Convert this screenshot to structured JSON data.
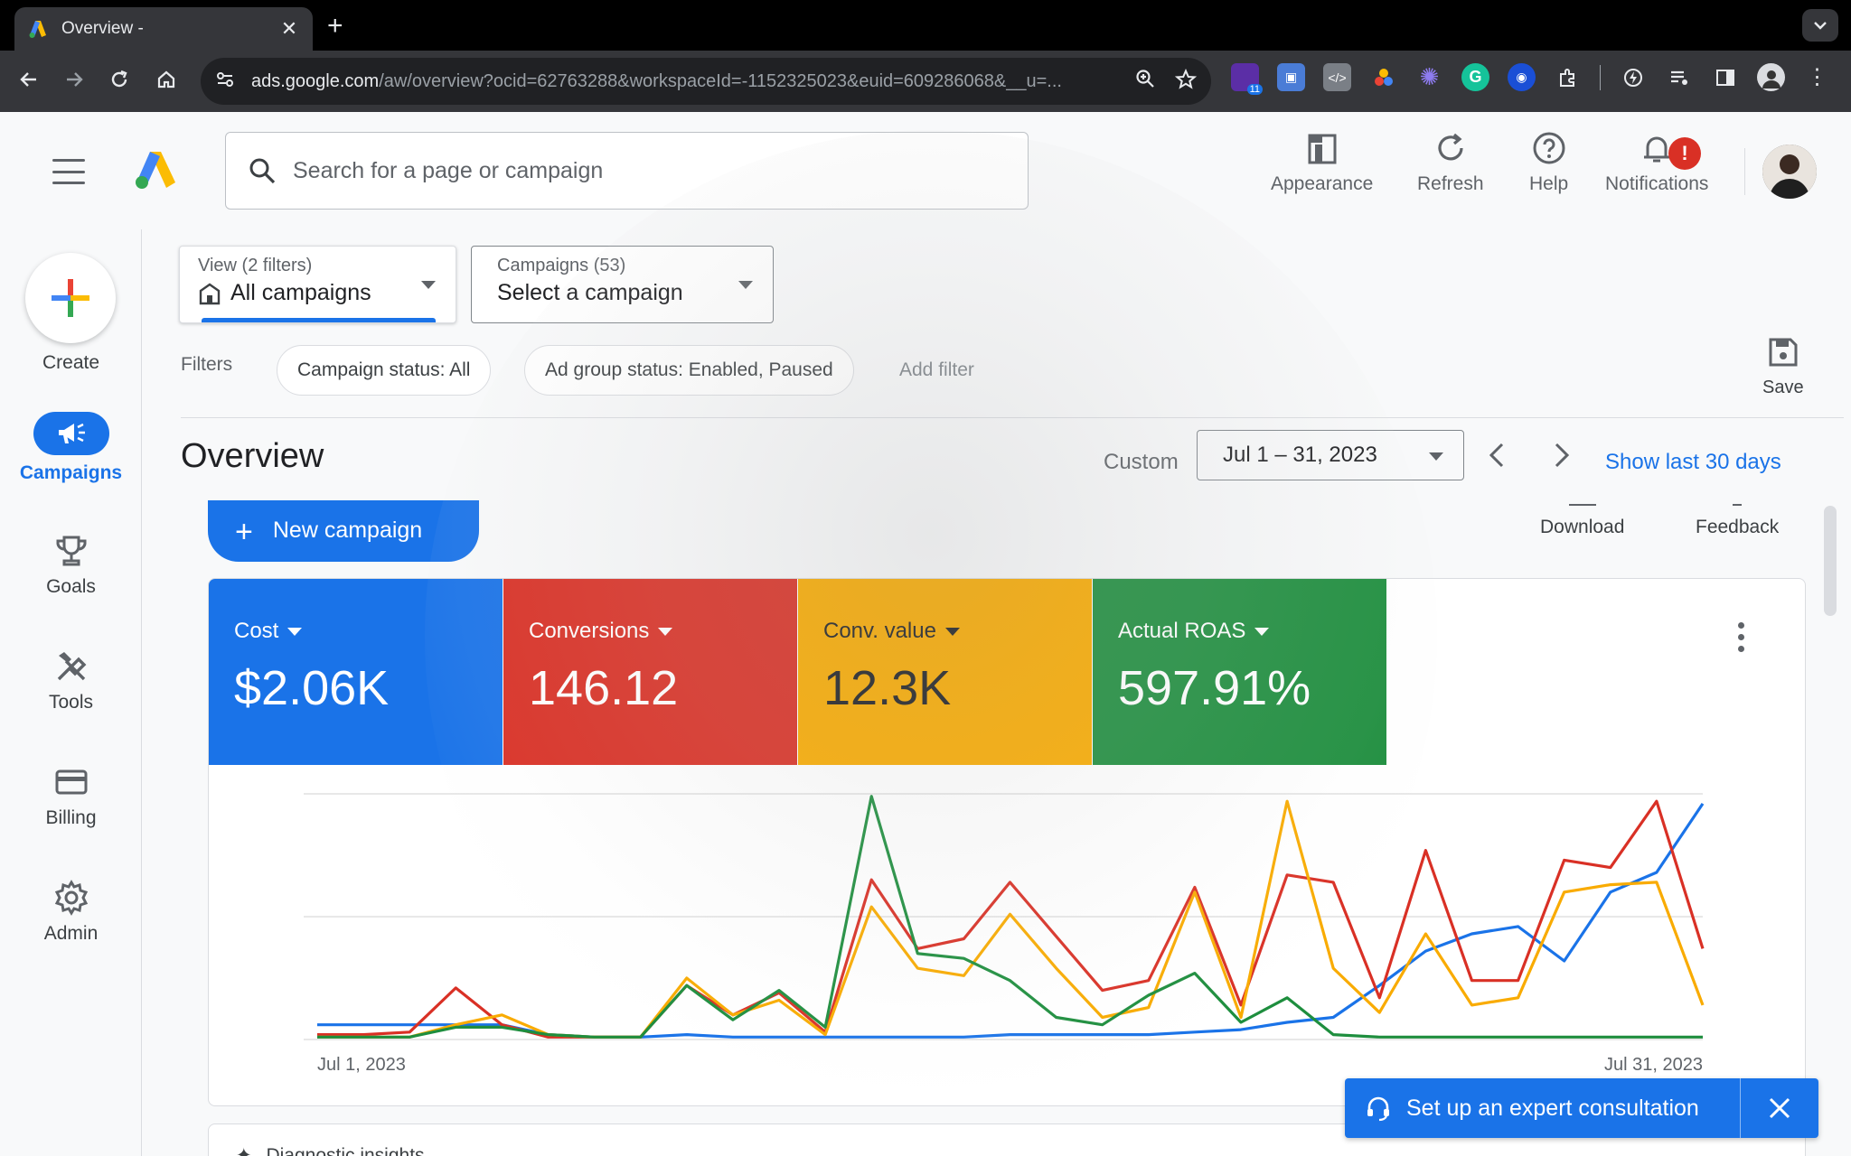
{
  "browser": {
    "tab_title": "Overview -",
    "url_host": "ads.google.com",
    "url_path": "/aw/overview?ocid=62763288&workspaceId=-1152325023&euid=609286068&__u=...",
    "extension_badge": "11"
  },
  "header": {
    "search_placeholder": "Search for a page or campaign",
    "appearance_label": "Appearance",
    "refresh_label": "Refresh",
    "help_label": "Help",
    "notifications_label": "Notifications",
    "notification_badge": "!"
  },
  "leftnav": {
    "create_label": "Create",
    "items": [
      {
        "label": "Campaigns",
        "icon": "megaphone-icon",
        "active": true
      },
      {
        "label": "Goals",
        "icon": "trophy-icon"
      },
      {
        "label": "Tools",
        "icon": "tools-icon"
      },
      {
        "label": "Billing",
        "icon": "credit-card-icon"
      },
      {
        "label": "Admin",
        "icon": "gear-icon"
      }
    ]
  },
  "view": {
    "sub": "View (2 filters)",
    "value": "All campaigns"
  },
  "campaign_select": {
    "sub": "Campaigns (53)",
    "value": "Select a campaign"
  },
  "filters": {
    "label": "Filters",
    "chips": [
      "Campaign status: All",
      "Ad group status: Enabled, Paused"
    ],
    "add_filter": "Add filter",
    "save_label": "Save"
  },
  "overview": {
    "title": "Overview",
    "custom_label": "Custom",
    "date_range": "Jul 1 – 31, 2023",
    "show_last": "Show last 30 days",
    "new_campaign": "New campaign",
    "download_label": "Download",
    "feedback_label": "Feedback"
  },
  "metrics": [
    {
      "label": "Cost",
      "value": "$2.06K",
      "color": "#1a73e8"
    },
    {
      "label": "Conversions",
      "value": "146.12",
      "color": "#d93025"
    },
    {
      "label": "Conv. value",
      "value": "12.3K",
      "color": "#f9ab00"
    },
    {
      "label": "Actual ROAS",
      "value": "597.91%",
      "color": "#1e8e3e"
    }
  ],
  "insights": {
    "title": "Diagnostic insights"
  },
  "expert": {
    "label": "Set up an expert consultation"
  },
  "chart_data": {
    "type": "line",
    "x_start_label": "Jul 1, 2023",
    "x_end_label": "Jul 31, 2023",
    "x": [
      1,
      2,
      3,
      4,
      5,
      6,
      7,
      8,
      9,
      10,
      11,
      12,
      13,
      14,
      15,
      16,
      17,
      18,
      19,
      20,
      21,
      22,
      23,
      24,
      25,
      26,
      27,
      28,
      29,
      30,
      31
    ],
    "ylim": [
      0,
      100
    ],
    "grid": true,
    "series": [
      {
        "color": "#1a73e8",
        "values": [
          6,
          6,
          6,
          6,
          6,
          2,
          1,
          1,
          2,
          1,
          1,
          1,
          1,
          1,
          1,
          2,
          2,
          2,
          2,
          3,
          4,
          7,
          9,
          22,
          36,
          43,
          46,
          32,
          60,
          68,
          96
        ]
      },
      {
        "color": "#d93025",
        "values": [
          2,
          2,
          3,
          21,
          6,
          1,
          1,
          1,
          22,
          10,
          19,
          3,
          65,
          37,
          41,
          64,
          42,
          20,
          24,
          62,
          14,
          67,
          64,
          17,
          77,
          24,
          24,
          73,
          70,
          97,
          37
        ]
      },
      {
        "color": "#f9ab00",
        "values": [
          1,
          1,
          1,
          6,
          10,
          2,
          1,
          1,
          25,
          10,
          16,
          2,
          54,
          29,
          26,
          51,
          29,
          9,
          13,
          60,
          9,
          97,
          29,
          11,
          43,
          14,
          17,
          60,
          63,
          64,
          14
        ]
      },
      {
        "color": "#1e8e3e",
        "values": [
          1,
          1,
          1,
          5,
          5,
          2,
          1,
          1,
          22,
          8,
          20,
          5,
          99,
          35,
          33,
          24,
          9,
          6,
          18,
          27,
          7,
          17,
          2,
          1,
          1,
          1,
          1,
          1,
          1,
          1,
          1
        ]
      }
    ]
  }
}
